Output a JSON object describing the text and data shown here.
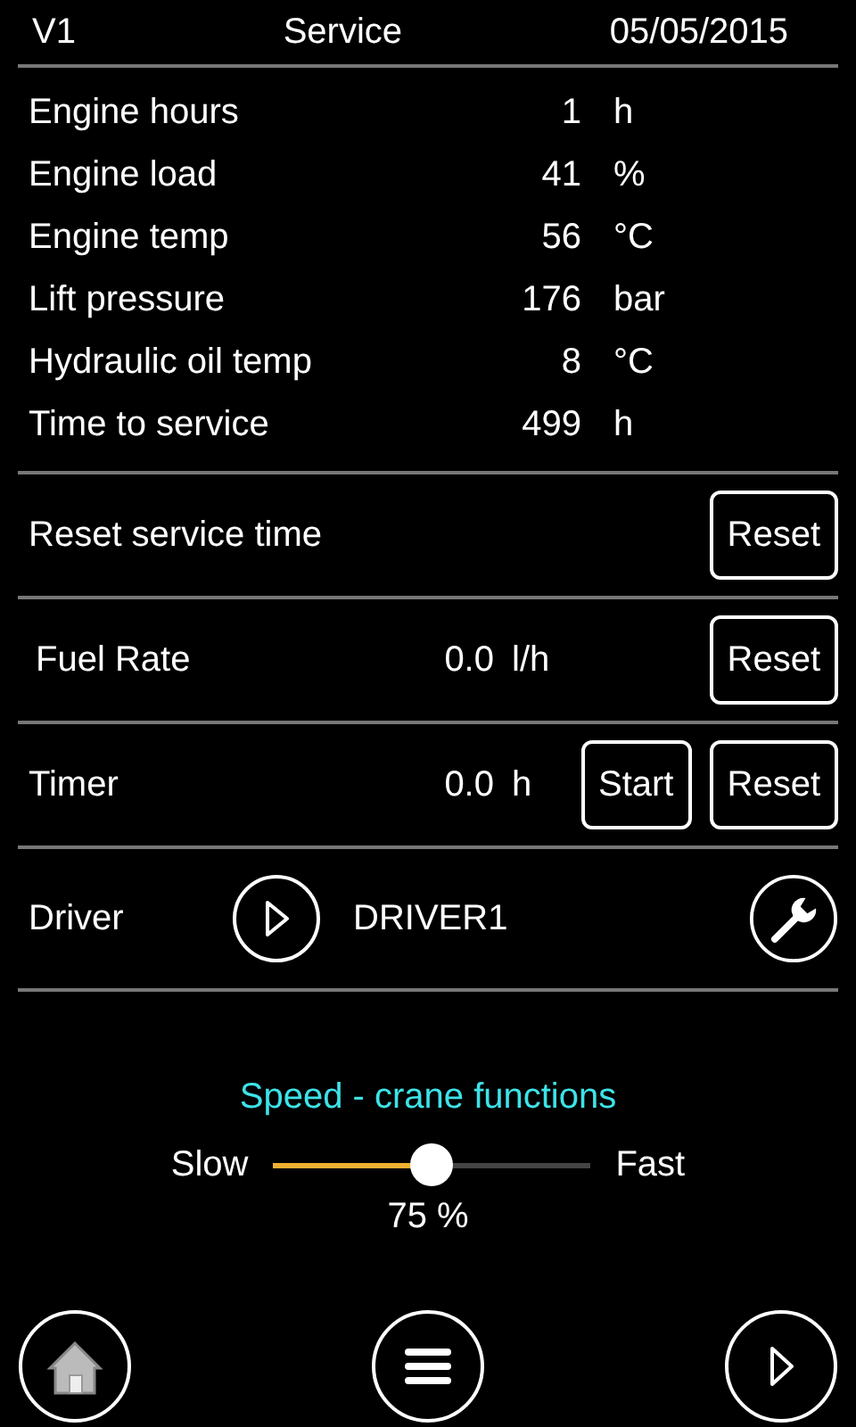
{
  "header": {
    "version": "V1",
    "title": "Service",
    "date": "05/05/2015"
  },
  "readings": [
    {
      "label": "Engine hours",
      "value": "1",
      "unit": "h"
    },
    {
      "label": "Engine load",
      "value": "41",
      "unit": "%"
    },
    {
      "label": "Engine temp",
      "value": "56",
      "unit": "°C"
    },
    {
      "label": "Lift pressure",
      "value": "176",
      "unit": "bar"
    },
    {
      "label": "Hydraulic oil temp",
      "value": "8",
      "unit": "°C"
    },
    {
      "label": "Time to service",
      "value": "499",
      "unit": "h"
    }
  ],
  "reset_service": {
    "label": "Reset service time",
    "button": "Reset"
  },
  "fuel_rate": {
    "label": "Fuel Rate",
    "value": "0.0",
    "unit": "l/h",
    "button": "Reset"
  },
  "timer": {
    "label": "Timer",
    "value": "0.0",
    "unit": "h",
    "start_button": "Start",
    "reset_button": "Reset"
  },
  "driver": {
    "label": "Driver",
    "name": "DRIVER1"
  },
  "speed": {
    "title": "Speed - crane functions",
    "min_label": "Slow",
    "max_label": "Fast",
    "level": 0.5,
    "reading": "75 %"
  }
}
